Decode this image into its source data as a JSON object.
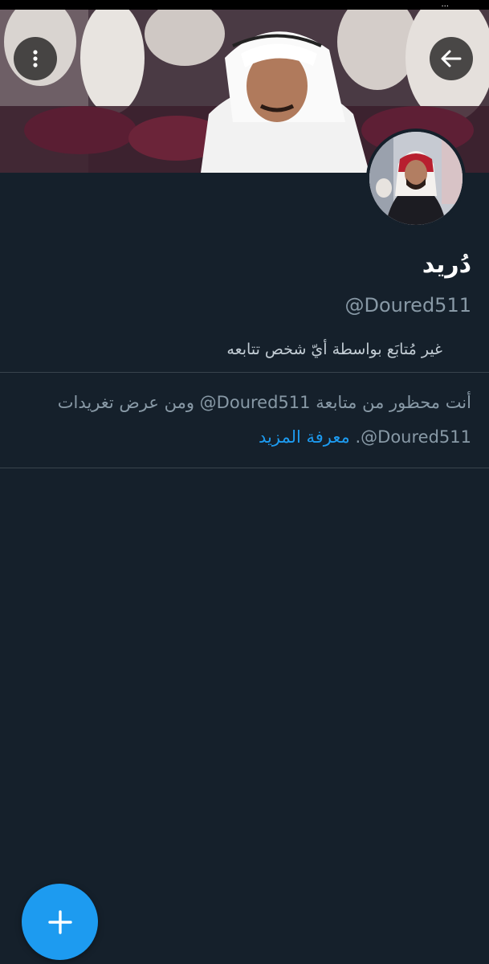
{
  "status_bar": {
    "text": "..."
  },
  "profile": {
    "display_name": "دُريد",
    "handle": "@Doured511",
    "follow_note": "غير مُتابَع بواسطة أيّ شخص تتابعه"
  },
  "blocked": {
    "message": "أنت محظور من متابعة ‎@Doured511‎ ومن عرض تغريدات ‎@Doured511‎.",
    "learn_more": "معرفة المزيد"
  },
  "icons": {
    "menu": "more-vertical-icon",
    "back": "arrow-left-icon",
    "compose": "plus-icon"
  },
  "colors": {
    "background": "#15202b",
    "accent": "#1d9bf0",
    "secondary_text": "#8899a6",
    "divider": "#38444d"
  }
}
